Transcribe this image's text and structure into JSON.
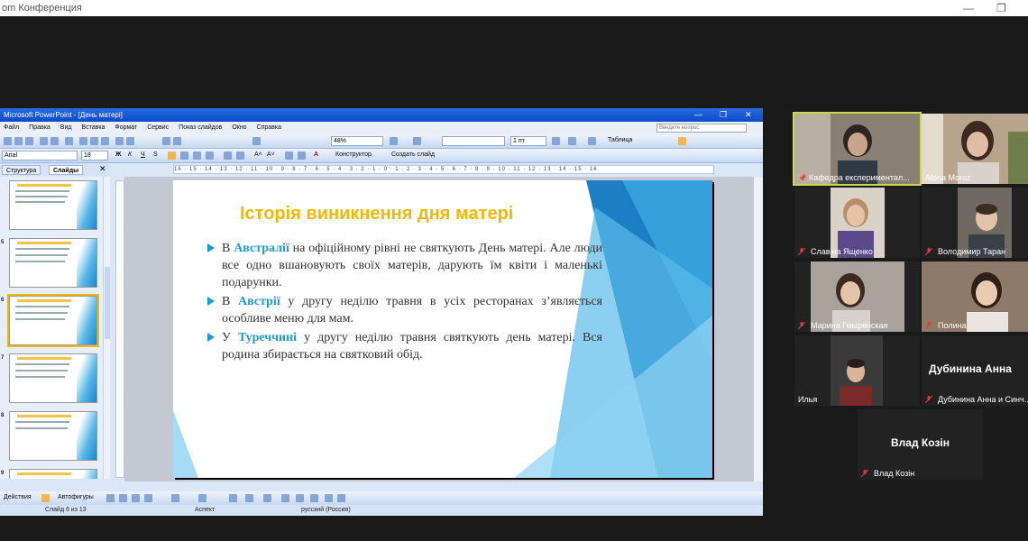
{
  "zoom": {
    "window_title": "om Конференция"
  },
  "ppt": {
    "window_title": "Microsoft PowerPoint - [День матері]",
    "menu": [
      "Файл",
      "Правка",
      "Вид",
      "Вставка",
      "Формат",
      "Сервис",
      "Показ слайдов",
      "Окно",
      "Справка"
    ],
    "ask_placeholder": "Введите вопрос",
    "zoom_level": "48%",
    "line_width": "1 пт",
    "table_label": "Таблица",
    "font_name": "Arial",
    "font_size": "18",
    "designer_label": "Конструктор",
    "new_slide_label": "Создать слайд",
    "tabs": [
      "Структура",
      "Слайды"
    ],
    "thumb_numbers": [
      "5",
      "6",
      "7",
      "8",
      "9"
    ],
    "ruler_h": "16 · 15 · 14 · 13 · 12 · 11 · 10 · 9 · 8 · 7 · 6 · 5 · 4 · 3 · 2 · 1 · 0 · 1 · 2 · 3 · 4 · 5 · 6 · 7 · 8 · 9 · 10 · 11 · 12 · 13 · 14 · 15 · 16",
    "actions_label": "Действия",
    "autoshapes_label": "Автофигуры",
    "status": {
      "slide": "Слайд 6 из 13",
      "design": "Аспект",
      "language": "русский (Россия)"
    }
  },
  "slide": {
    "title": "Історія виникнення дня матері",
    "bullets": [
      {
        "pre": "В ",
        "hl": "Австралії",
        "post": " на офіційному рівні не святкують День матері. Але люди все одно вшановують своїх матерів, дарують їм квіти і маленькі подарунки."
      },
      {
        "pre": "В ",
        "hl": "Австрії",
        "post": " у другу неділю травня в усіх ресторанах з’являється особливе меню для мам."
      },
      {
        "pre": "У ",
        "hl": "Туреччині",
        "post": " у другу неділю травня святкують день матері. Вся родина збирається на святковий обід."
      }
    ]
  },
  "participants": [
    {
      "name": "Кафедра експериментал...",
      "muted": false,
      "pinned": true,
      "active": true,
      "video": true,
      "bg": "#8a7f74"
    },
    {
      "name": "Alona Moroz",
      "muted": false,
      "video": true,
      "bg": "#b8a48c"
    },
    {
      "name": "Славіна Ященко",
      "muted": true,
      "video": true,
      "bg": "#d9d2c6"
    },
    {
      "name": "Володимир Таран",
      "muted": true,
      "video": true,
      "bg": "#6e6a62"
    },
    {
      "name": "Марина Гмырянская",
      "muted": true,
      "video": true,
      "bg": "#a8a29a"
    },
    {
      "name": "Полина",
      "muted": true,
      "video": true,
      "bg": "#7a6a5c"
    },
    {
      "name": "Илья",
      "muted": false,
      "video": true,
      "bg": "#3a3a3a"
    },
    {
      "name": "Дубинина Анна и Синч...",
      "big": "Дубинина Анна",
      "muted": true,
      "video": false
    },
    {
      "name": "Влад Козін",
      "big": "Влад Козін",
      "muted": true,
      "video": false
    }
  ]
}
